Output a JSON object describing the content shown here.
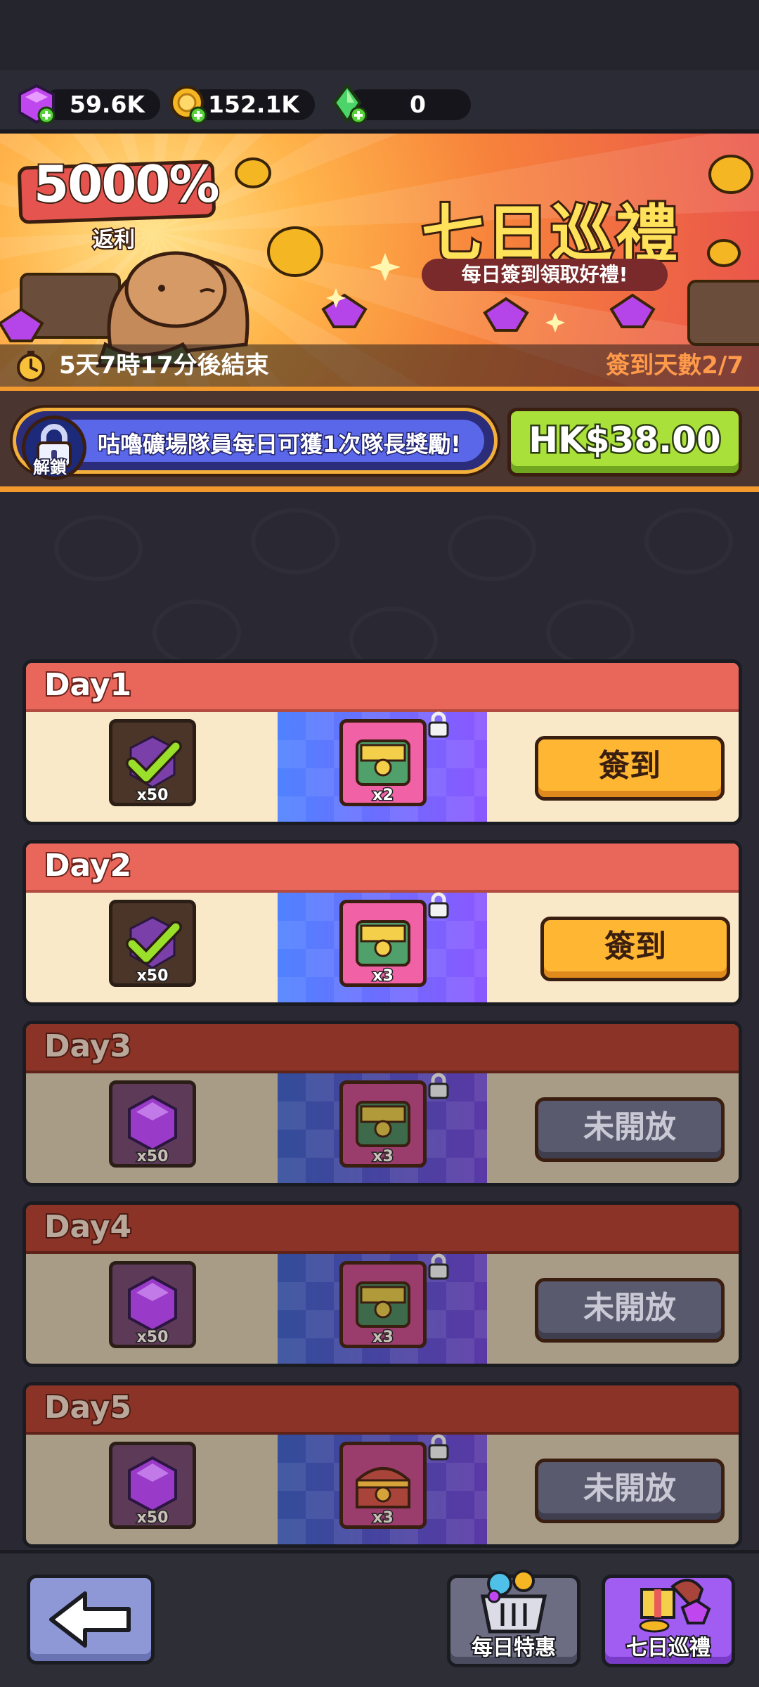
{
  "currencies": {
    "gems": "59.6K",
    "coins": "152.1K",
    "crystals": "0"
  },
  "banner": {
    "rebate_percent": "5000%",
    "rebate_label": "返利",
    "title": "七日巡禮",
    "subtitle": "每日簽到領取好禮!",
    "countdown": "5天7時17分後結束",
    "sign_days": "簽到天數2/7"
  },
  "unlock": {
    "lock_label": "解鎖",
    "text": "咕嚕礦場隊員每日可獲1次隊長獎勵!",
    "price": "HK$38.00"
  },
  "days": [
    {
      "label": "Day1",
      "reward1_qty": "x50",
      "reward2_qty": "x2",
      "action": "簽到",
      "state": "claimed"
    },
    {
      "label": "Day2",
      "reward1_qty": "x50",
      "reward2_qty": "x3",
      "action": "簽到",
      "state": "claimed"
    },
    {
      "label": "Day3",
      "reward1_qty": "x50",
      "reward2_qty": "x3",
      "action": "未開放",
      "state": "locked"
    },
    {
      "label": "Day4",
      "reward1_qty": "x50",
      "reward2_qty": "x3",
      "action": "未開放",
      "state": "locked"
    },
    {
      "label": "Day5",
      "reward1_qty": "x50",
      "reward2_qty": "x3",
      "action": "未開放",
      "state": "locked"
    }
  ],
  "bottom_nav": {
    "daily_deals": "每日特惠",
    "seven_day": "七日巡禮"
  },
  "icons": {
    "gem": "gem-icon",
    "coin": "coin-icon",
    "crystal": "crystal-icon",
    "timer": "stopwatch-icon",
    "lock": "lock-icon",
    "checkmark": "checkmark-icon",
    "chest": "chest-icon",
    "back": "back-arrow-icon"
  },
  "colors": {
    "sign_button": "#ffb733",
    "closed_button": "#5a5a6e",
    "price_button": "#a9e03a",
    "day_header_active": "#e8665a",
    "day_header_locked": "#8a3326"
  }
}
